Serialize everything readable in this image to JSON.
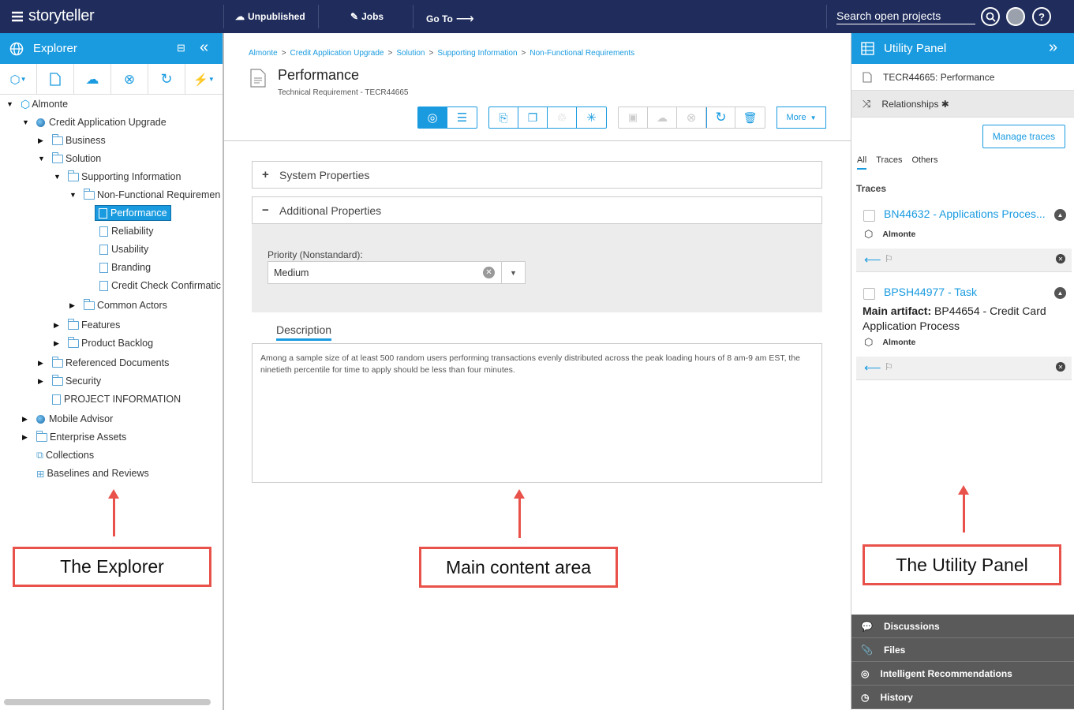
{
  "topbar": {
    "logo": "storyteller",
    "unpublished": "Unpublished",
    "jobs": "Jobs",
    "goto": "Go To",
    "search_placeholder": "Search open projects",
    "help": "?"
  },
  "explorer": {
    "title": "Explorer",
    "tree": [
      {
        "label": "Almonte",
        "icon": "cube-icon",
        "toggle": "▼",
        "level": 0
      },
      {
        "label": "Credit Application Upgrade",
        "icon": "globe-icon",
        "toggle": "▼",
        "level": 1
      },
      {
        "label": "Business",
        "icon": "folder-icon",
        "toggle": "▶",
        "level": 2
      },
      {
        "label": "Solution",
        "icon": "folder-icon",
        "toggle": "▼",
        "level": 2
      },
      {
        "label": "Supporting Information",
        "icon": "folder-icon",
        "toggle": "▼",
        "level": 3
      },
      {
        "label": "Non-Functional Requiremen",
        "icon": "folder-icon",
        "toggle": "▼",
        "level": 4
      },
      {
        "label": "Performance",
        "icon": "document-icon",
        "toggle": "",
        "level": 5,
        "selected": true
      },
      {
        "label": "Reliability",
        "icon": "document-icon",
        "toggle": "",
        "level": 5
      },
      {
        "label": "Usability",
        "icon": "document-icon",
        "toggle": "",
        "level": 5
      },
      {
        "label": "Branding",
        "icon": "document-icon",
        "toggle": "",
        "level": 5
      },
      {
        "label": "Credit Check Confirmatic",
        "icon": "document-icon",
        "toggle": "",
        "level": 5
      },
      {
        "label": "Common Actors",
        "icon": "folder-icon",
        "toggle": "▶",
        "level": 4
      },
      {
        "label": "Features",
        "icon": "folder-icon",
        "toggle": "▶",
        "level": 3
      },
      {
        "label": "Product Backlog",
        "icon": "folder-icon",
        "toggle": "▶",
        "level": 3
      },
      {
        "label": "Referenced Documents",
        "icon": "folder-icon",
        "toggle": "▶",
        "level": 2
      },
      {
        "label": "Security",
        "icon": "folder-icon",
        "toggle": "▶",
        "level": 2
      },
      {
        "label": "PROJECT INFORMATION",
        "icon": "document-icon",
        "toggle": "",
        "level": 2
      },
      {
        "label": "Mobile Advisor",
        "icon": "globe-icon",
        "toggle": "▶",
        "level": 1
      },
      {
        "label": "Enterprise Assets",
        "icon": "folder-icon",
        "toggle": "▶",
        "level": 1
      },
      {
        "label": "Collections",
        "icon": "collections-icon",
        "toggle": "",
        "level": 1
      },
      {
        "label": "Baselines and Reviews",
        "icon": "baselines-icon",
        "toggle": "",
        "level": 1
      }
    ]
  },
  "main": {
    "breadcrumb": [
      "Almonte",
      "Credit Application Upgrade",
      "Solution",
      "Supporting Information",
      "Non-Functional Requirements"
    ],
    "title": "Performance",
    "subtitle": "Technical Requirement - TECR44665",
    "more_label": "More",
    "system_properties": "System Properties",
    "additional_properties": "Additional Properties",
    "priority_label": "Priority (Nonstandard):",
    "priority_value": "Medium",
    "description_tab": "Description",
    "description_text": "Among a sample size of at least 500 random users performing transactions evenly distributed across the peak loading hours of 8 am-9 am EST, the ninetieth percentile for time to apply should be less than four minutes."
  },
  "utility": {
    "title": "Utility Panel",
    "artifact": "TECR44665: Performance",
    "relationships": "Relationships",
    "manage_traces": "Manage traces",
    "tabs": [
      "All",
      "Traces",
      "Others"
    ],
    "traces_heading": "Traces",
    "trace1": {
      "link": "BN44632 - Applications Proces...",
      "project": "Almonte"
    },
    "trace2": {
      "link": "BPSH44977 - Task",
      "main_label": "Main artifact:",
      "main_value": "BP44654 - Credit Card Application Process",
      "project": "Almonte"
    },
    "bottom": [
      "Discussions",
      "Files",
      "Intelligent Recommendations",
      "History"
    ]
  },
  "annotations": {
    "explorer": "The Explorer",
    "main": "Main content area",
    "utility": "The Utility Panel"
  },
  "colors": {
    "accent": "#1a9be0",
    "topbar": "#1f2c5c",
    "annotation": "#e9524a"
  }
}
